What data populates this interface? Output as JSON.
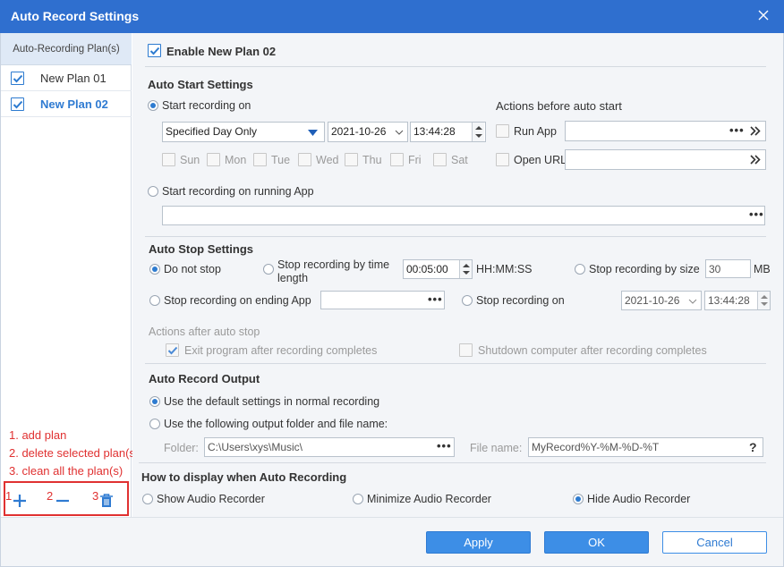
{
  "window": {
    "title": "Auto Record Settings"
  },
  "sidebar": {
    "header": "Auto-Recording Plan(s)",
    "plans": [
      {
        "label": "New Plan 01",
        "checked": true,
        "selected": false
      },
      {
        "label": "New Plan 02",
        "checked": true,
        "selected": true
      }
    ],
    "annotations": [
      "1. add plan",
      "2. delete selected plan(s)",
      "3. clean all the plan(s)"
    ],
    "tool_numbers": [
      "1",
      "2",
      "3"
    ]
  },
  "enable_plan": {
    "label": "Enable New Plan 02",
    "checked": true
  },
  "auto_start": {
    "title": "Auto Start Settings",
    "start_on_label": "Start recording on",
    "mode_value": "Specified Day Only",
    "date": "2021-10-26",
    "time": "13:44:28",
    "days": [
      "Sun",
      "Mon",
      "Tue",
      "Wed",
      "Thu",
      "Fri",
      "Sat"
    ],
    "start_on_app_label": "Start recording on running App",
    "actions_title": "Actions before auto start",
    "run_app_label": "Run App",
    "open_url_label": "Open URL"
  },
  "auto_stop": {
    "title": "Auto Stop Settings",
    "do_not_stop": "Do not stop",
    "by_time_label": "Stop recording by time length",
    "time_length": "00:05:00",
    "time_unit": "HH:MM:SS",
    "by_size_label": "Stop recording by size",
    "size_value": "30",
    "size_unit": "MB",
    "ending_app_label": "Stop recording on ending App",
    "stop_on_label": "Stop recording on",
    "stop_date": "2021-10-26",
    "stop_time": "13:44:28",
    "actions_after_title": "Actions after auto stop",
    "exit_program_label": "Exit program after recording completes",
    "shutdown_label": "Shutdown computer after recording completes"
  },
  "output": {
    "title": "Auto Record Output",
    "default_label": "Use the default settings in normal recording",
    "custom_label": "Use the following output folder and file name:",
    "folder_label": "Folder:",
    "folder_value": "C:\\Users\\xys\\Music\\",
    "filename_label": "File name:",
    "filename_value": "MyRecord%Y-%M-%D-%T",
    "help": "?"
  },
  "display": {
    "title": "How to display when Auto Recording",
    "options": [
      "Show Audio Recorder",
      "Minimize Audio Recorder",
      "Hide Audio Recorder"
    ],
    "selected": "Hide Audio Recorder"
  },
  "buttons": {
    "apply": "Apply",
    "ok": "OK",
    "cancel": "Cancel"
  },
  "colors": {
    "accent": "#2f6fcf",
    "annotation": "#e03131"
  }
}
